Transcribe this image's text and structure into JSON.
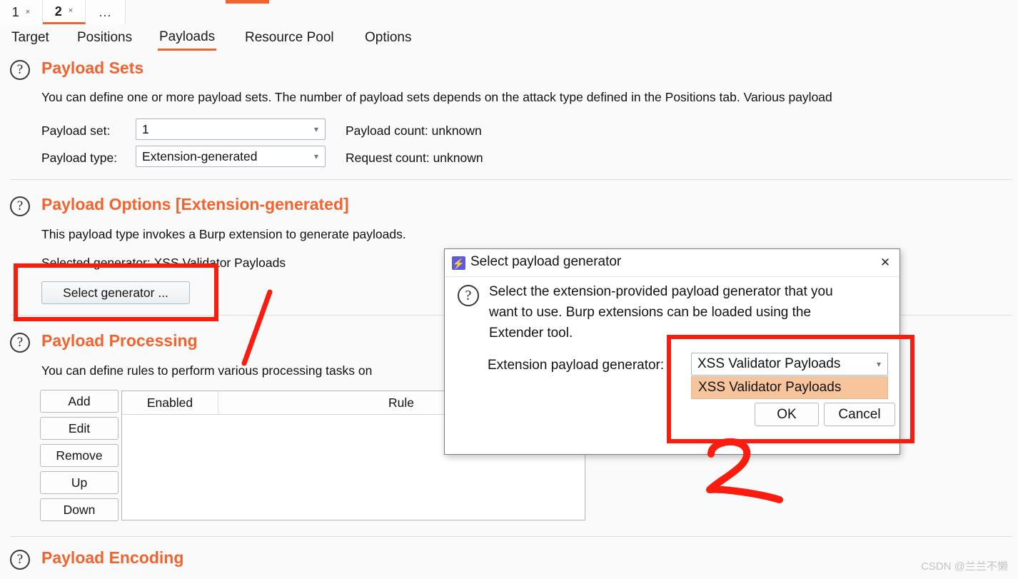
{
  "attack_tabs": {
    "items": [
      {
        "label": "1",
        "close": "×",
        "selected": false
      },
      {
        "label": "2",
        "close": "×",
        "selected": true
      },
      {
        "label": "...",
        "close": "",
        "selected": false
      }
    ]
  },
  "inner_tabs": {
    "items": [
      {
        "label": "Target",
        "selected": false
      },
      {
        "label": "Positions",
        "selected": false
      },
      {
        "label": "Payloads",
        "selected": true
      },
      {
        "label": "Resource Pool",
        "selected": false
      },
      {
        "label": "Options",
        "selected": false
      }
    ]
  },
  "payload_sets": {
    "help_icon": "question-mark-icon",
    "title": "Payload Sets",
    "description": "You can define one or more payload sets. The number of payload sets depends on the attack type defined in the Positions tab. Various payload",
    "payload_set_label": "Payload set:",
    "payload_set_value": "1",
    "payload_type_label": "Payload type:",
    "payload_type_value": "Extension-generated",
    "payload_count": "Payload count: unknown",
    "request_count": "Request count: unknown"
  },
  "payload_options": {
    "help_icon": "question-mark-icon",
    "title": "Payload Options [Extension-generated]",
    "description": "This payload type invokes a Burp extension to generate payloads.",
    "selected_generator": "Selected generator: XSS Validator Payloads",
    "select_generator_button": "Select generator ..."
  },
  "payload_processing": {
    "help_icon": "question-mark-icon",
    "title": "Payload Processing",
    "description": "You can define rules to perform various processing tasks on",
    "buttons": [
      "Add",
      "Edit",
      "Remove",
      "Up",
      "Down"
    ],
    "columns": [
      "Enabled",
      "Rule"
    ],
    "rows": []
  },
  "payload_encoding": {
    "help_icon": "question-mark-icon",
    "title": "Payload Encoding"
  },
  "dialog": {
    "app_icon": "burp-lightning-icon",
    "app_icon_glyph": "⚡",
    "title": "Select payload generator",
    "close_icon": "close-icon",
    "close_glyph": "✕",
    "help_icon": "question-mark-icon",
    "description_lines": [
      "Select the extension-provided payload generator that you",
      "want to use. Burp extensions can be loaded using the",
      "Extender tool."
    ],
    "generator_label": "Extension payload generator:",
    "generator_value": "XSS Validator Payloads",
    "dropdown_options": [
      "XSS Validator Payloads"
    ],
    "ok_label": "OK",
    "cancel_label": "Cancel"
  },
  "annotations": {
    "box_1_target": "select-generator-button",
    "box_2_target": "extension-payload-generator-dropdown",
    "step_marker": "2",
    "arrow": "hand-drawn-arrow"
  },
  "watermark": "CSDN @兰兰不懒",
  "colors": {
    "accent_orange": "#f4622d",
    "annotation_red": "#fb1c10",
    "dropdown_highlight": "#f7c49c",
    "page_background": "#fafafa",
    "dialog_icon_purple": "#5b5be0"
  }
}
